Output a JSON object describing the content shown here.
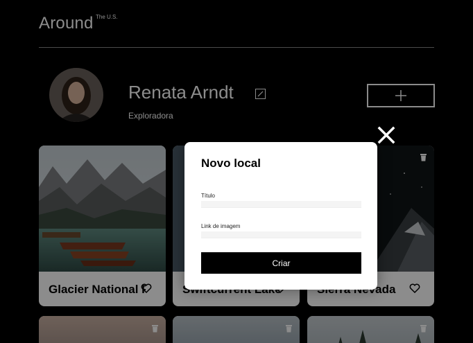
{
  "header": {
    "logo": "Around",
    "logo_sup": "The U.S."
  },
  "profile": {
    "name": "Renata Arndt",
    "role": "Exploradora"
  },
  "cards": [
    {
      "title": "Glacier National Park"
    },
    {
      "title": "Swiftcurrent Lake"
    },
    {
      "title": "Sierra Nevada"
    }
  ],
  "modal": {
    "title": "Novo local",
    "title_label": "Título",
    "link_label": "Link de imagem",
    "submit_label": "Criar"
  },
  "colors": {
    "background": "#000000",
    "card": "#ffffff",
    "button": "#000000"
  },
  "icons": {
    "close": "close-icon",
    "edit": "pencil-icon",
    "add": "plus-icon",
    "like": "heart-icon",
    "delete": "trash-icon"
  }
}
